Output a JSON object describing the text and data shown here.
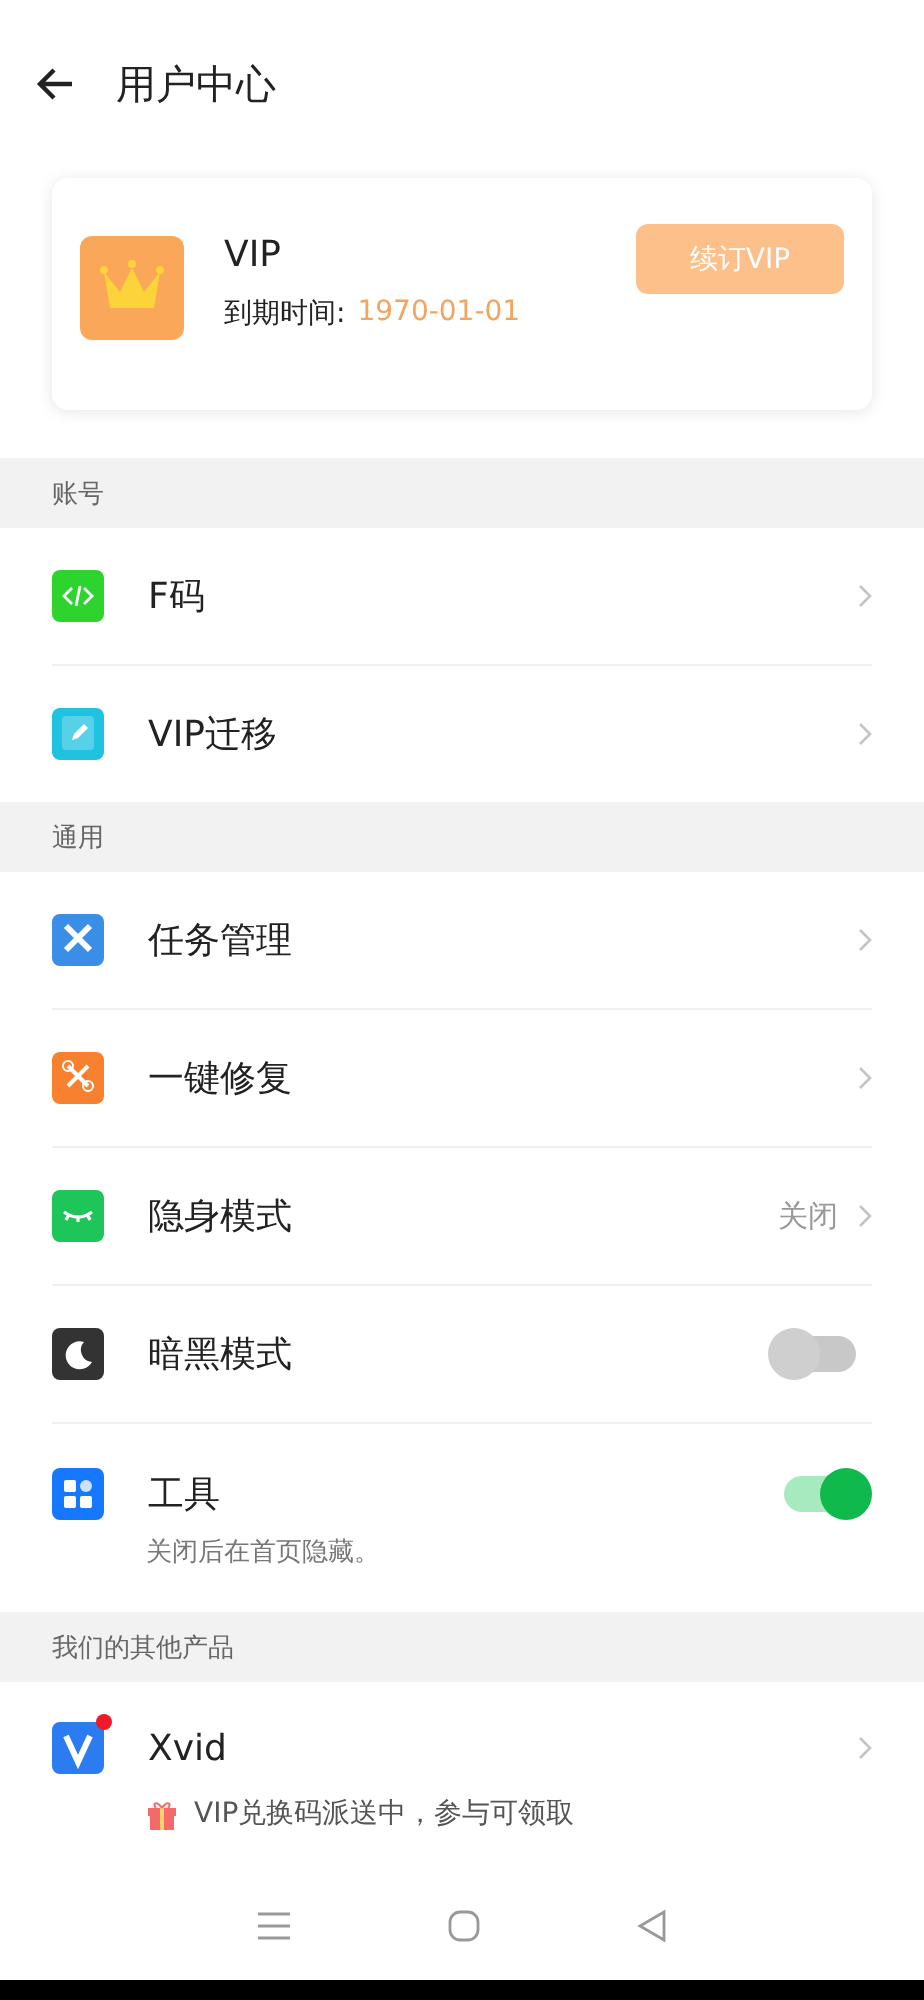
{
  "header": {
    "title": "用户中心"
  },
  "vip_card": {
    "title": "VIP",
    "expiry_label": "到期时间:",
    "expiry_date": "1970-01-01",
    "renew_button": "续订VIP"
  },
  "sections": [
    {
      "title": "账号",
      "items": [
        {
          "kind": "link",
          "label": "F码"
        },
        {
          "kind": "link",
          "label": "VIP迁移"
        }
      ]
    },
    {
      "title": "通用",
      "items": [
        {
          "kind": "link",
          "label": "任务管理"
        },
        {
          "kind": "link",
          "label": "一键修复"
        },
        {
          "kind": "link",
          "label": "隐身模式",
          "value": "关闭"
        },
        {
          "kind": "toggle",
          "label": "暗黑模式",
          "on": false
        },
        {
          "kind": "toggle",
          "label": "工具",
          "on": true,
          "subtitle": "关闭后在首页隐藏。"
        }
      ]
    },
    {
      "title": "我们的其他产品",
      "items": [
        {
          "kind": "link",
          "label": "Xvid",
          "badge": true,
          "promo": "VIP兑换码派送中，参与可领取"
        }
      ]
    }
  ]
}
